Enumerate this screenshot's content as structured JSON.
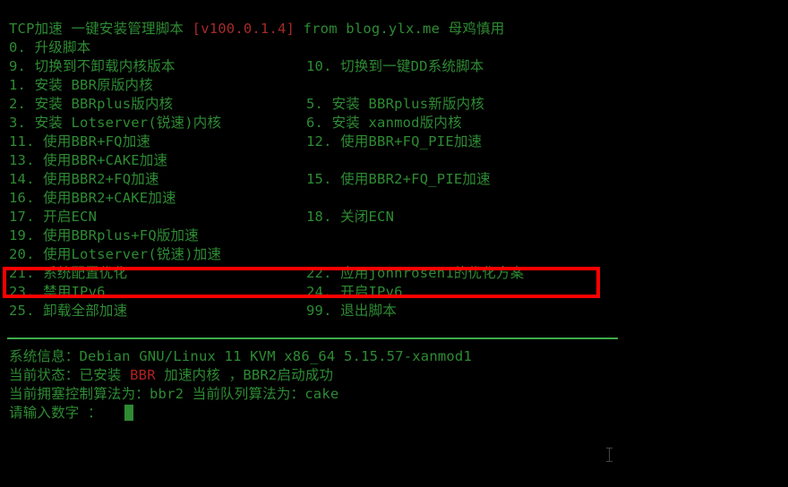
{
  "terminal": {
    "background_color": "#000000",
    "text_color": "#2e8b33",
    "accent_red": "#a52a2a",
    "separator_color": "#3faa4a",
    "highlight_color": "#ff0000"
  },
  "header": {
    "title_prefix": "TCP加速 一键安装管理脚本 ",
    "version": "[v100.0.1.4]",
    "title_suffix": " from blog.ylx.me 母鸡慎用"
  },
  "menu": {
    "rows": [
      {
        "left": "0. 升级脚本",
        "right": ""
      },
      {
        "left": "9. 切换到不卸载内核版本",
        "right": "10. 切换到一键DD系统脚本"
      },
      {
        "left": "1. 安装 BBR原版内核",
        "right": ""
      },
      {
        "left": "2. 安装 BBRplus版内核",
        "right": "5. 安装 BBRplus新版内核"
      },
      {
        "left": "3. 安装 Lotserver(锐速)内核",
        "right": "6. 安装 xanmod版内核"
      },
      {
        "left": "11. 使用BBR+FQ加速",
        "right": "12. 使用BBR+FQ_PIE加速"
      },
      {
        "left": "13. 使用BBR+CAKE加速",
        "right": ""
      },
      {
        "left": "14. 使用BBR2+FQ加速",
        "right": "15. 使用BBR2+FQ_PIE加速"
      },
      {
        "left": "16. 使用BBR2+CAKE加速",
        "right": ""
      },
      {
        "left": "17. 开启ECN",
        "right": "18. 关闭ECN"
      },
      {
        "left": "19. 使用BBRplus+FQ版加速",
        "right": ""
      },
      {
        "left": "20. 使用Lotserver(锐速)加速",
        "right": ""
      },
      {
        "left": "21. 系统配置优化",
        "right": "22. 应用johnrosen1的优化方案"
      },
      {
        "left": "23. 禁用IPv6",
        "right": "24. 开启IPv6"
      },
      {
        "left": "25. 卸载全部加速",
        "right": "99. 退出脚本"
      }
    ]
  },
  "status": {
    "sysinfo_label": "系统信息：",
    "sysinfo_value": "Debian GNU/Linux 11 KVM x86_64 5.15.57-xanmod1",
    "state_prefix": "当前状态：已安装 ",
    "state_highlight": "BBR",
    "state_suffix": " 加速内核 ，BBR2启动成功",
    "algo_line": "当前拥塞控制算法为：bbr2 当前队列算法为：cake",
    "prompt": "请输入数字 ："
  },
  "annotation": {
    "highlight_target": "21. 系统配置优化 / 22. 应用johnrosen1的优化方案"
  }
}
